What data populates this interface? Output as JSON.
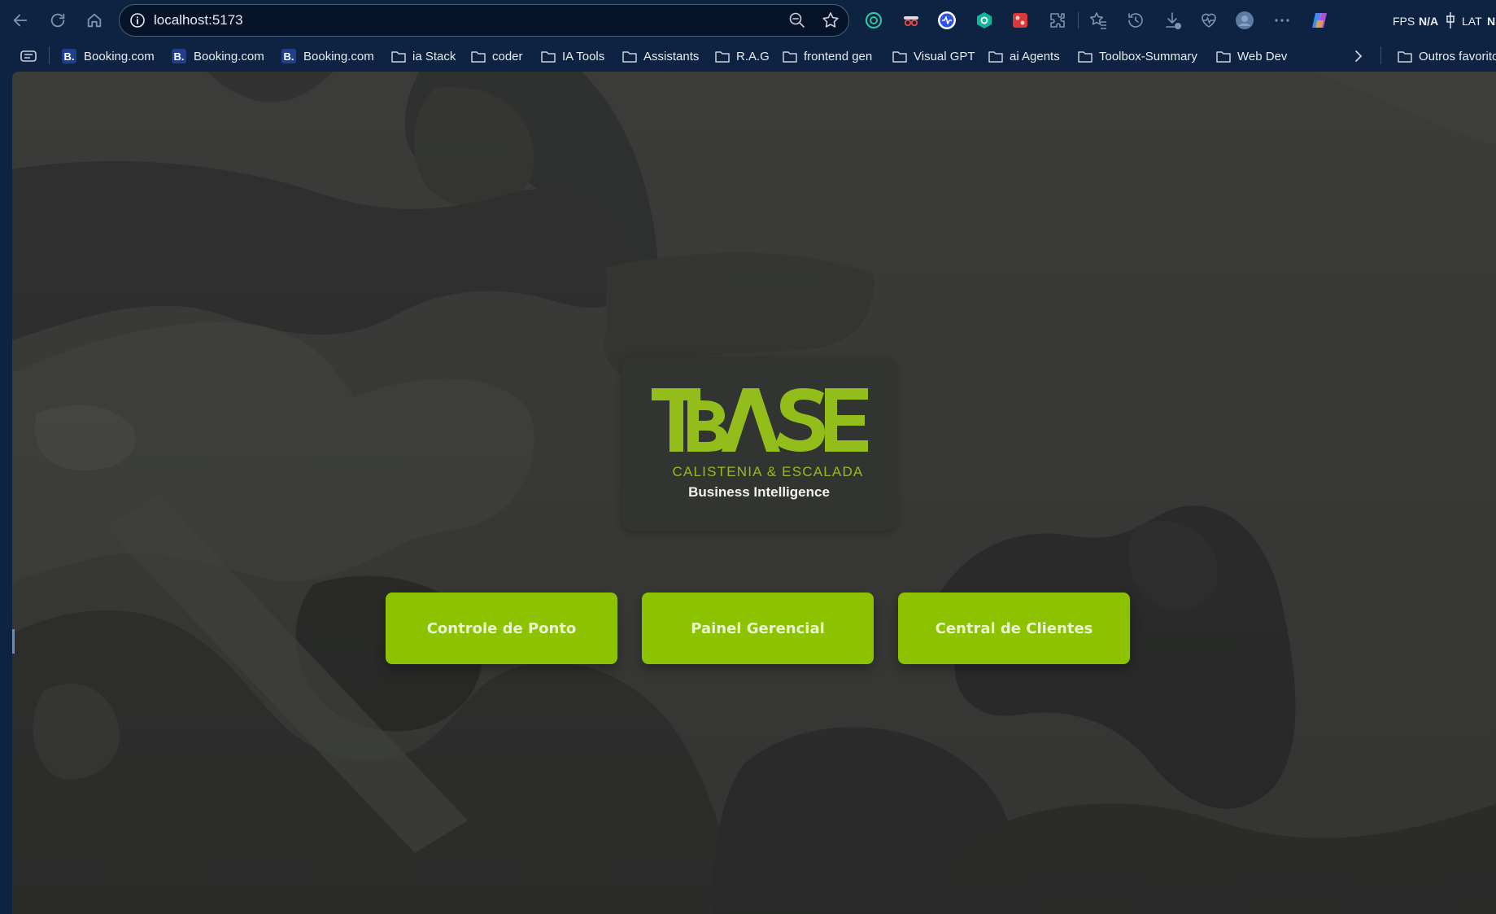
{
  "browser": {
    "url": "localhost:5173",
    "hud": {
      "fps_label": "FPS",
      "fps_value": "N/A",
      "lat_label": "LAT",
      "lat_value": "N"
    }
  },
  "bookmarks": [
    {
      "label": "Booking.com",
      "type": "site",
      "badge": "B."
    },
    {
      "label": "Booking.com",
      "type": "site",
      "badge": "B."
    },
    {
      "label": "Booking.com",
      "type": "site",
      "badge": "B."
    },
    {
      "label": "ia Stack",
      "type": "folder"
    },
    {
      "label": "coder",
      "type": "folder"
    },
    {
      "label": "IA Tools",
      "type": "folder"
    },
    {
      "label": "Assistants",
      "type": "folder"
    },
    {
      "label": "R.A.G",
      "type": "folder"
    },
    {
      "label": "frontend gen",
      "type": "folder"
    },
    {
      "label": "Visual GPT",
      "type": "folder"
    },
    {
      "label": "ai Agents",
      "type": "folder"
    },
    {
      "label": "Toolbox-Summary",
      "type": "folder"
    },
    {
      "label": "Web Dev",
      "type": "folder"
    }
  ],
  "other_bookmarks": "Outros favoritos",
  "app": {
    "logo_text": "BASE",
    "logo_subtitle": "CALISTENIA & ESCALADA",
    "logo_tagline": "Business Intelligence",
    "buttons": {
      "ponto": "Controle de Ponto",
      "painel": "Painel Gerencial",
      "clientes": "Central de Clientes"
    }
  },
  "colors": {
    "chrome_bg": "#0d2341",
    "page_bg": "#3a3b38",
    "accent_green": "#8dc201",
    "logo_green": "#93bd1a",
    "card_bg": "#323431"
  }
}
